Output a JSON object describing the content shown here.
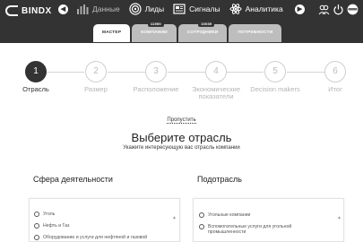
{
  "header": {
    "brand": "BINDX",
    "nav": [
      {
        "label": "Данные",
        "icon": "bar-chart-icon",
        "active": false
      },
      {
        "label": "Лиды",
        "icon": "target-icon",
        "active": true
      },
      {
        "label": "Сигналы",
        "icon": "news-icon",
        "active": true
      },
      {
        "label": "Аналитика",
        "icon": "atom-icon",
        "active": true
      }
    ]
  },
  "tabs": [
    {
      "label": "МАСТЕР",
      "badge": ""
    },
    {
      "label": "КОМПАНИИ",
      "badge": "11590"
    },
    {
      "label": "СОТРУДНИКИ",
      "badge": "10039"
    },
    {
      "label": "ПОТРЕБНОСТИ",
      "badge": ""
    }
  ],
  "steps": [
    {
      "num": "1",
      "label": "Отрасль"
    },
    {
      "num": "2",
      "label": "Размер"
    },
    {
      "num": "3",
      "label": "Расположение"
    },
    {
      "num": "4",
      "label": "Экономические показатели"
    },
    {
      "num": "5",
      "label": "Decision makers"
    },
    {
      "num": "6",
      "label": "Итог"
    }
  ],
  "skip_label": "Пропустить",
  "title": "Выберите отрасль",
  "subtitle": "Укажите интересующую вас отрасль компании",
  "sphere": {
    "heading": "Сфера деятельности",
    "options": [
      "Уголь",
      "Нефть и Газ",
      "Оборудование и услуги для нефтяной и газовой"
    ]
  },
  "subindustry": {
    "heading": "Подотрасль",
    "options": [
      "Угольные компании",
      "Вспомогательные услуги для угольной промышленности"
    ]
  },
  "colors": {
    "topbar": "#333333",
    "tab_inactive": "#bdbdbd",
    "step_active": "#333333"
  }
}
